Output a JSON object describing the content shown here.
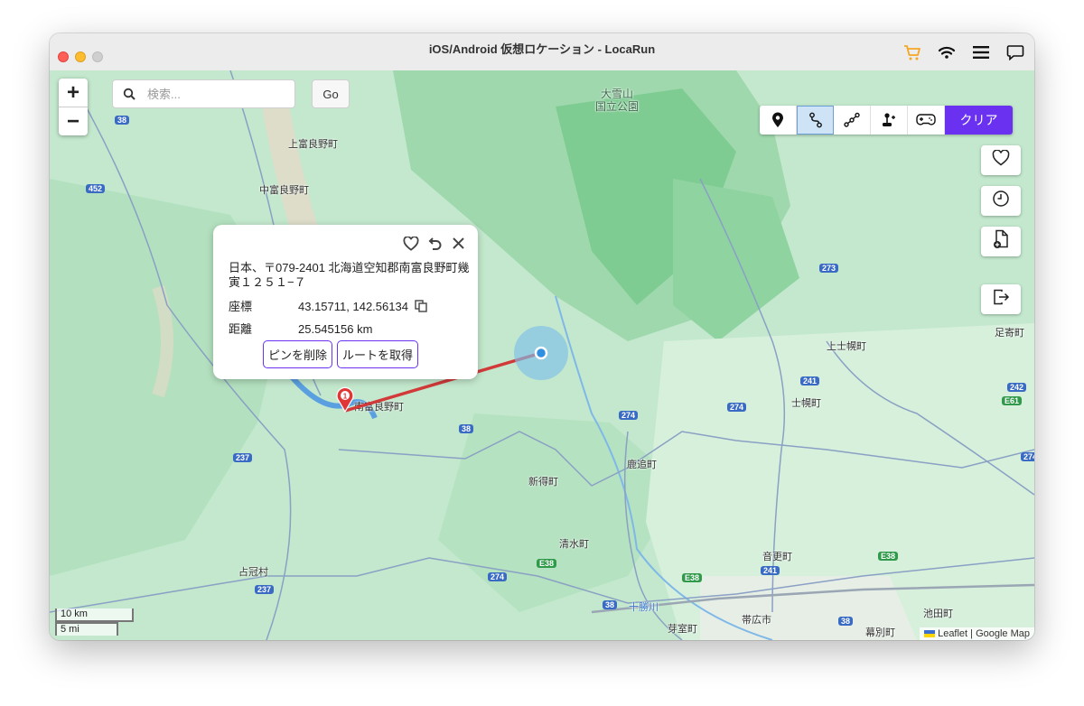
{
  "window": {
    "title": "iOS/Android 仮想ロケーション - LocaRun",
    "toolbar_icons": [
      "cart-icon",
      "wifi-icon",
      "menu-icon",
      "chat-icon"
    ],
    "accent_color": "#6a32f0",
    "cart_color": "#f5a623"
  },
  "search": {
    "placeholder": "検索...",
    "go_label": "Go"
  },
  "zoom": {
    "in_label": "+",
    "out_label": "−"
  },
  "mode_bar": {
    "modes": [
      "teleport-pin-icon",
      "two-spot-route-icon",
      "multi-spot-route-icon",
      "joystick-icon",
      "gamepad-icon"
    ],
    "active_mode": "two-spot-route-icon",
    "clear_label": "クリア"
  },
  "side_buttons": [
    "favorite-heart-icon",
    "history-clock-icon",
    "import-gpx-file-icon",
    "exit-icon"
  ],
  "popup": {
    "address": "日本、〒079-2401 北海道空知郡南富良野町幾寅１２５１−７",
    "coord_label": "座標",
    "coord_value": "43.15711, 142.56134",
    "distance_label": "距離",
    "distance_value": "25.545156 km",
    "delete_pin_label": "ピンを削除",
    "get_route_label": "ルートを取得"
  },
  "map_labels": {
    "park1": "大雪山",
    "park2": "国立公園",
    "kami_furano": "上富良野町",
    "naka_furano": "中富良野町",
    "minami_furano": "南富良野町",
    "shintoku": "新得町",
    "shimizu": "清水町",
    "shikaoi": "鹿追町",
    "kamishihoro": "上士幌町",
    "shihoro": "士幌町",
    "otofuke": "音更町",
    "obihiro": "帯広市",
    "memuro": "芽室町",
    "shimukappu": "占冠村",
    "ashoro": "足寄町",
    "ikeda": "池田町",
    "makubetsu": "幕別町",
    "tokachi_river": "十勝川"
  },
  "road_shields": [
    "38",
    "452",
    "237",
    "273",
    "241",
    "242",
    "274",
    "E38",
    "E61",
    "38",
    "274",
    "E38",
    "274",
    "E38",
    "241",
    "237",
    "38",
    "274",
    "38"
  ],
  "scale": {
    "metric": "10 km",
    "imperial": "5 mi"
  },
  "attribution": "Leaflet | Google Map"
}
